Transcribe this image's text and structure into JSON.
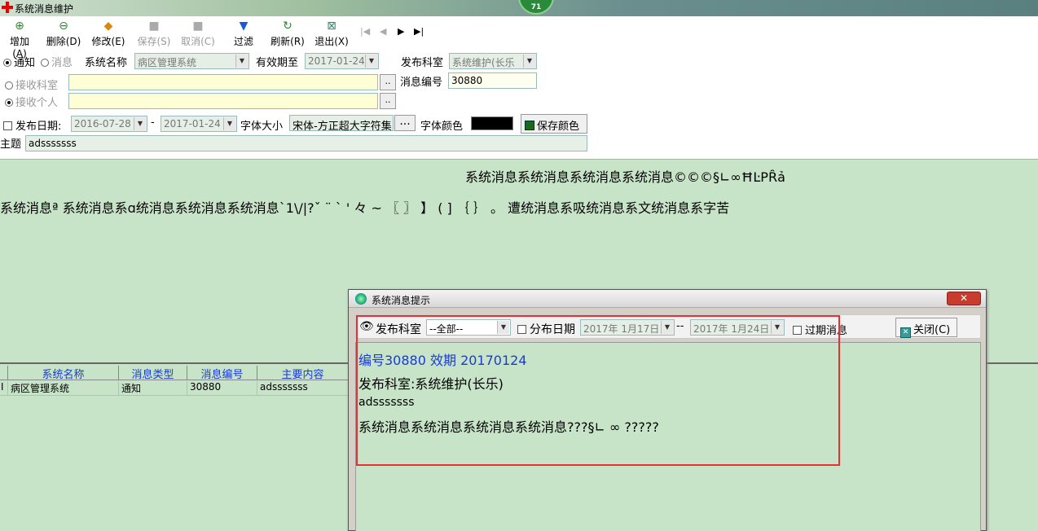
{
  "window": {
    "title": "系统消息维护",
    "badge": "71"
  },
  "toolbar": {
    "add": "增加(A)",
    "delete": "删除(D)",
    "modify": "修改(E)",
    "save": "保存(S)",
    "cancel": "取消(C)",
    "filter": "过滤",
    "refresh": "刷新(R)",
    "exit": "退出(X)",
    "nav_first": "|◀",
    "nav_prev": "◀",
    "nav_next": "▶",
    "nav_last": "▶|"
  },
  "form": {
    "type_notice": "通知",
    "type_message": "消息",
    "system_name_label": "系统名称",
    "system_name_value": "病区管理系统",
    "valid_until_label": "有效期至",
    "valid_until_value": "2017-01-24",
    "publish_dept_label": "发布科室",
    "publish_dept_value": "系统维护(长乐",
    "receive_dept_label": "接收科室",
    "receive_person_label": "接收个人",
    "msg_no_label": "消息编号",
    "msg_no_value": "30880",
    "publish_date_label": "发布日期:",
    "publish_date_from": "2016-07-28",
    "publish_date_sep": "-",
    "publish_date_to": "2017-01-24",
    "font_size_label": "字体大小",
    "font_size_value": "宋体-方正超大字符集",
    "font_color_label": "字体颜色",
    "font_color": "#000000",
    "save_color": "保存颜色",
    "subject_label": "主题",
    "subject_value": "adsssssss",
    "dots": "...",
    "ellipsis": ".."
  },
  "message_panel": {
    "line1": "系统消息系统消息系统消息系统消息©©©§∟∞ĦĿPȒả",
    "line2": "系统消息ª 系统消息系ɑ统消息系统消息系统消息`1\\/|?ˇ ¨ ` ' 々 ~ 〖 〗 】 ( ] ｛ ｝ 。 遭统消息系吸统消息系文统消息系字苦"
  },
  "grid": {
    "columns": [
      "系统名称",
      "消息类型",
      "消息编号",
      "主要内容"
    ],
    "rows": [
      {
        "marker": "I",
        "system": "病区管理系统",
        "type": "通知",
        "no": "30880",
        "content": "adsssssss"
      }
    ]
  },
  "dialog": {
    "title": "系统消息提示",
    "close_x": "✕",
    "dept_label": "发布科室",
    "dept_value": "--全部--",
    "date_label": "分布日期",
    "date_from": "2017年 1月17日",
    "date_sep": "--",
    "date_to": "2017年 1月24日",
    "expired_label": "过期消息",
    "close_btn": "关闭(C)",
    "lines": {
      "l1": "编号30880 效期 20170124",
      "l2": "发布科室:系统维护(长乐)",
      "l3": "adsssssss",
      "l4": "系统消息系统消息系统消息系统消息???§∟ ∞ ?????"
    },
    "accent": "#1a3ad8",
    "highlight": "#e83030"
  }
}
